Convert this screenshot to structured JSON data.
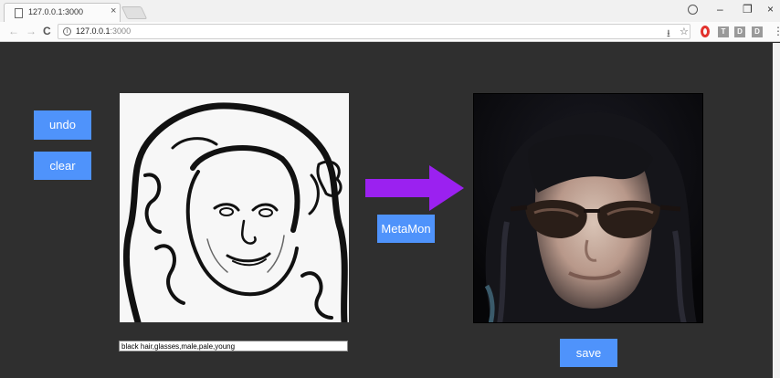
{
  "browser": {
    "tab_title": "127.0.0.1:3000",
    "tab_close": "×",
    "url_host": "127.0.0.1",
    "url_port": ":3000",
    "nav": {
      "back": "←",
      "forward": "→",
      "reload": "C"
    },
    "window_controls": {
      "minimize": "–",
      "restore": "❐",
      "close": "×"
    },
    "toolbar_icons": {
      "download": "⭳",
      "star": "☆",
      "menu": "⋮"
    },
    "extensions": [
      "T",
      "D",
      "D"
    ],
    "info": "i"
  },
  "app": {
    "undo_label": "undo",
    "clear_label": "clear",
    "convert_label": "MetaMon",
    "save_label": "save",
    "attributes_value": "black hair,glasses,male,pale,young"
  },
  "colors": {
    "page_background": "#2f2f2f",
    "button": "#4f93fb",
    "arrow": "#9b21f0"
  },
  "icons": {
    "arrow": "arrow-right-icon",
    "account": "account-icon",
    "opera": "opera-icon"
  }
}
